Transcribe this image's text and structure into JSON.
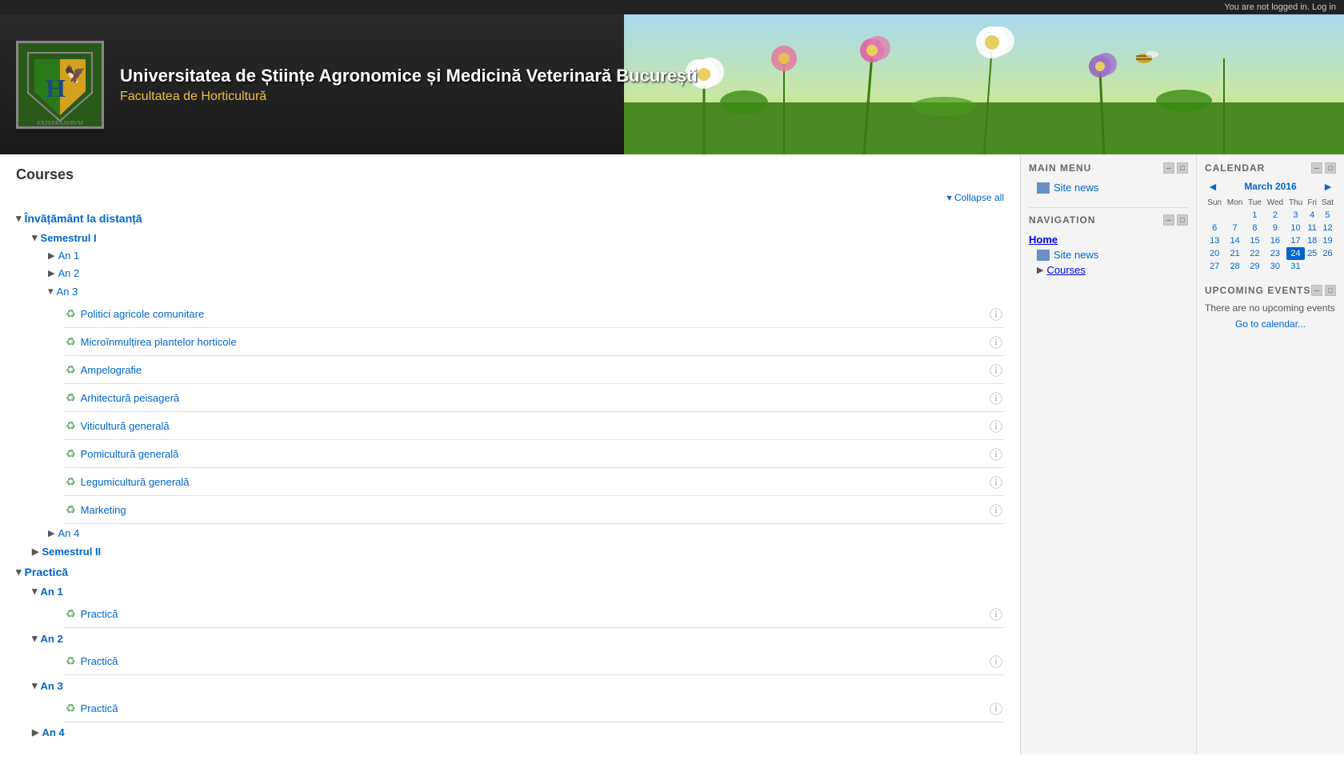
{
  "topbar": {
    "not_logged_text": "You are not logged in.",
    "login_link": "Log in"
  },
  "header": {
    "university_name": "Universitatea de Științe Agronomice și Medicină Veterinară București",
    "faculty_name": "Facultatea de Horticultură"
  },
  "page": {
    "title": "Courses",
    "collapse_label": "Collapse all"
  },
  "main_menu": {
    "label": "MAIN MENU",
    "site_news_label": "Site news"
  },
  "navigation": {
    "label": "NAVIGATION",
    "home_label": "Home",
    "site_news_label": "Site news",
    "courses_label": "Courses"
  },
  "calendar": {
    "label": "CALENDAR",
    "month": "March 2016",
    "days_of_week": [
      "Sun",
      "Mon",
      "Tue",
      "Wed",
      "Thu",
      "Fri",
      "Sat"
    ],
    "weeks": [
      [
        null,
        null,
        1,
        2,
        3,
        4,
        5
      ],
      [
        6,
        7,
        8,
        9,
        10,
        11,
        12
      ],
      [
        13,
        14,
        15,
        16,
        17,
        18,
        19
      ],
      [
        20,
        21,
        22,
        23,
        24,
        25,
        26
      ],
      [
        27,
        28,
        29,
        30,
        31,
        null,
        null
      ]
    ],
    "today": 24,
    "weekend_cols": [
      0,
      6
    ]
  },
  "upcoming_events": {
    "label": "UPCOMING EVENTS",
    "empty_text": "There are no upcoming events",
    "go_to_calendar": "Go to calendar..."
  },
  "courses": {
    "invatamant": {
      "label": "Învățământ la distanță",
      "semestrul_1": {
        "label": "Semestrul I",
        "an1": {
          "label": "An 1",
          "collapsed": true
        },
        "an2": {
          "label": "An 2",
          "collapsed": true
        },
        "an3": {
          "label": "An 3",
          "collapsed": false,
          "courses": [
            {
              "name": "Politici agricole comunitare"
            },
            {
              "name": "Microînmulțirea plantelor horticole"
            },
            {
              "name": "Ampelografie"
            },
            {
              "name": "Arhitectură peisageră"
            },
            {
              "name": "Viticultură generală"
            },
            {
              "name": "Pomicultură generală"
            },
            {
              "name": "Legumicultură generală"
            },
            {
              "name": "Marketing"
            }
          ]
        },
        "an4": {
          "label": "An 4",
          "collapsed": true
        }
      },
      "semestrul_2": {
        "label": "Semestrul II",
        "collapsed": true
      }
    },
    "practica": {
      "label": "Practică",
      "an1": {
        "label": "An 1",
        "courses": [
          {
            "name": "Practică"
          }
        ]
      },
      "an2": {
        "label": "An 2",
        "courses": [
          {
            "name": "Practică"
          }
        ]
      },
      "an3": {
        "label": "An 3",
        "courses": [
          {
            "name": "Practică"
          }
        ]
      },
      "an4": {
        "label": "An 4",
        "collapsed": true
      }
    }
  }
}
